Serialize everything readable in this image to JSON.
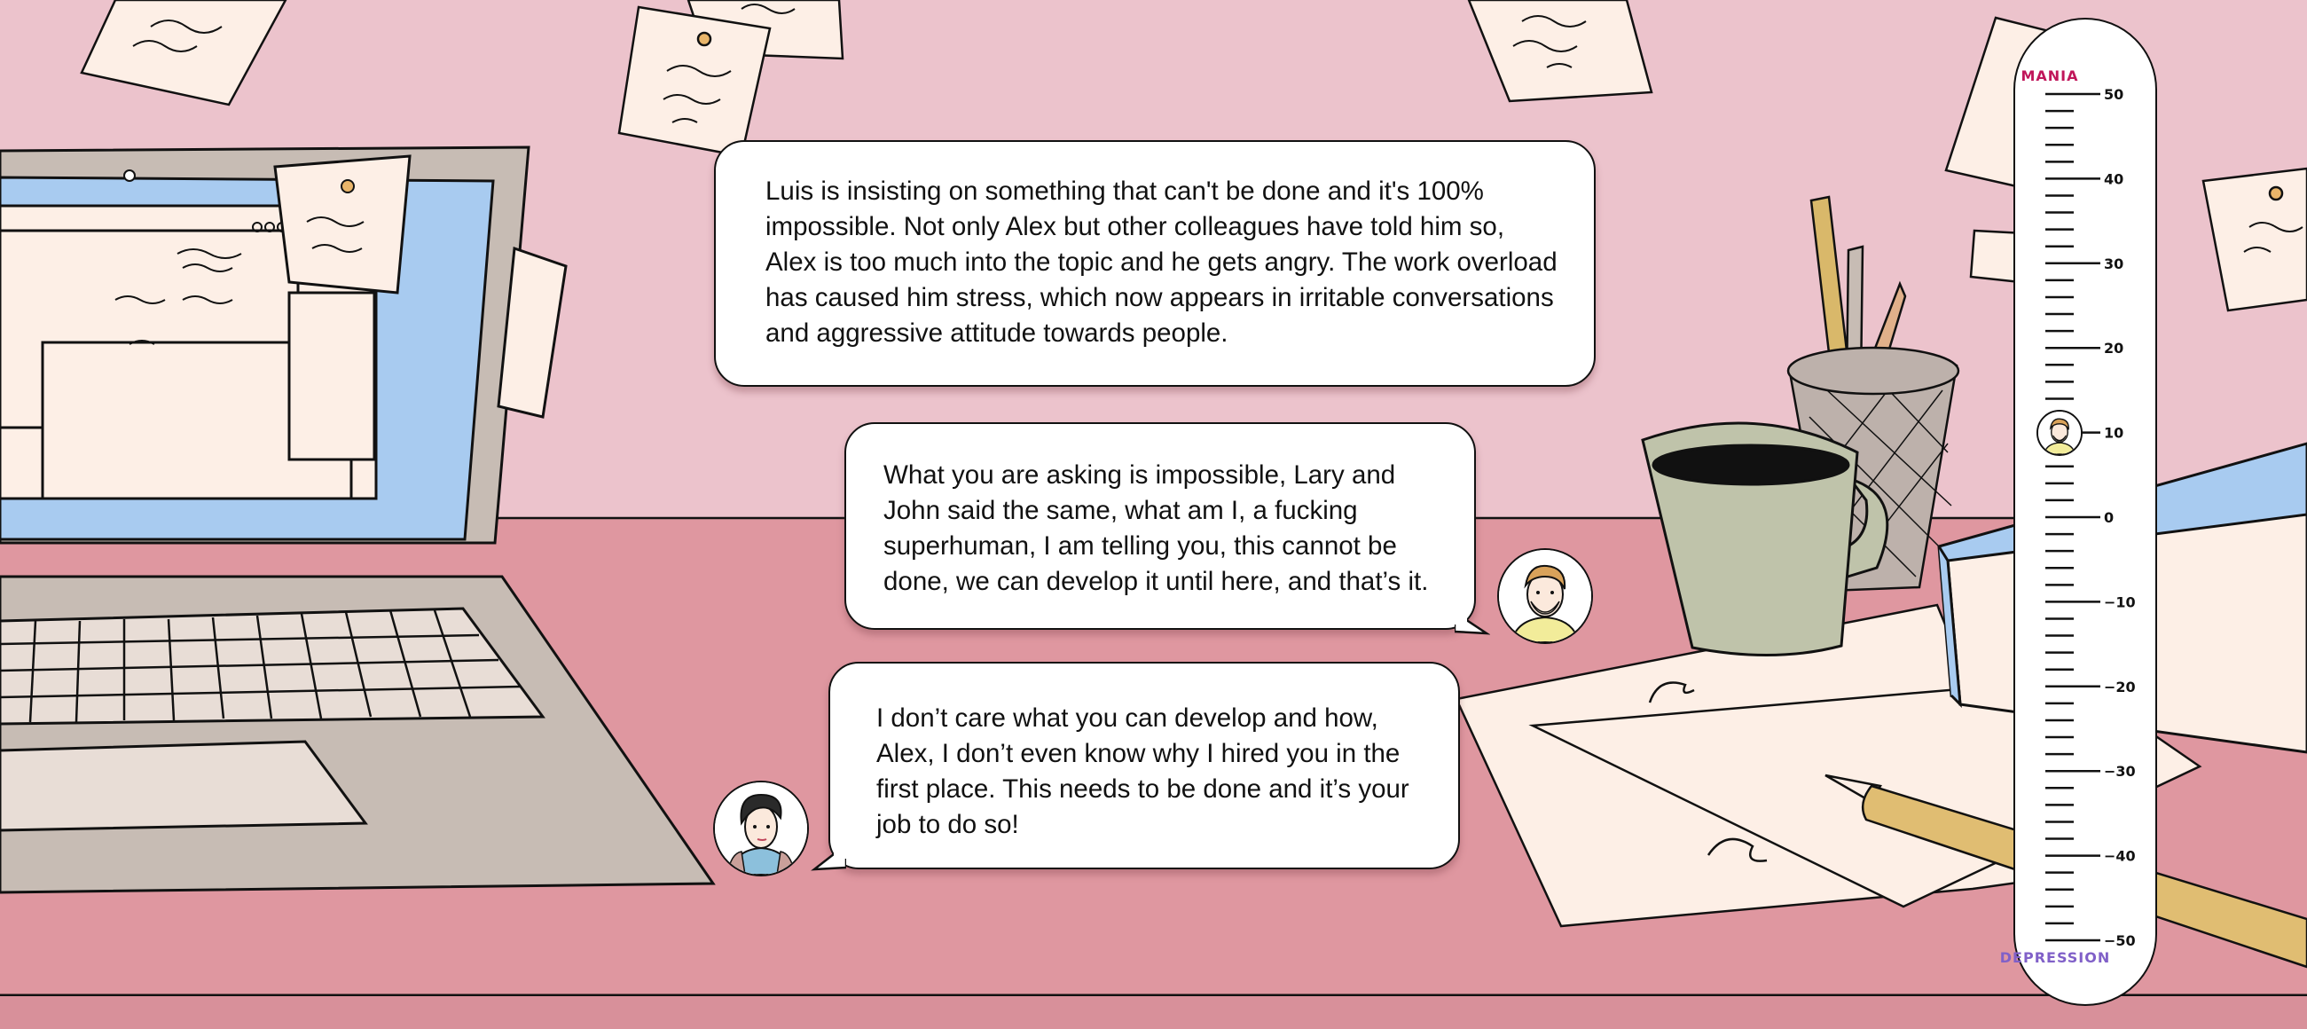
{
  "dialogue": {
    "narration": "Luis is insisting on something that can't be done and it's 100% impossible. Not only Alex but other colleagues have told him so, Alex is too much into the topic and he gets angry. The work overload has caused him stress, which now appears in irritable conversations and aggressive attitude towards people.",
    "alex_line": "What you are asking is impossible, Lary and John said the same, what am I, a fucking superhuman, I am telling you, this cannot be done, we can develop it until here, and that’s it.",
    "boss_line": "I don’t care what you can develop and how, Alex, I don’t even know why I hired you in the first place. This needs to be done and it’s your job to do so!"
  },
  "mood_meter": {
    "top_label": "MANIA",
    "bottom_label": "DEPRESSION",
    "max": 50,
    "min": -50,
    "major_step": 10,
    "minor_step": 2,
    "current_value": 10,
    "tick_labels": [
      "50",
      "40",
      "30",
      "20",
      "10",
      "0",
      "−10",
      "−20",
      "−30",
      "−40",
      "−50"
    ]
  },
  "colors": {
    "wall": "#ecc3cc",
    "desk": "#df97a0",
    "mania": "#c0165a",
    "depression": "#8060c8",
    "screen": "#a8cbf0",
    "paper": "#fdefe6"
  }
}
